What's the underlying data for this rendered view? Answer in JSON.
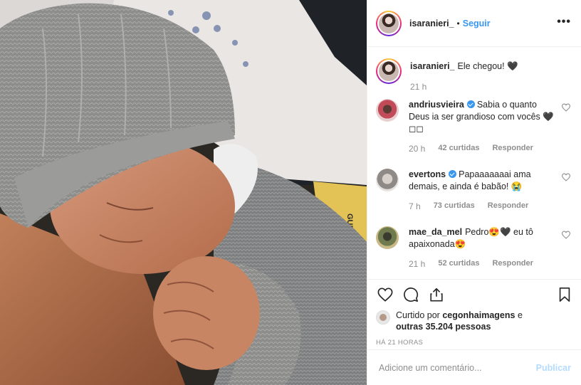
{
  "header": {
    "username": "isaranieri_",
    "separator": "•",
    "follow_label": "Seguir",
    "more_label": "•••"
  },
  "caption": {
    "username": "isaranieri_",
    "text": "Ele chegou! 🖤",
    "time": "21 h"
  },
  "comments": [
    {
      "username": "andriusvieira",
      "verified": true,
      "text": "Sabia o quanto Deus ia ser grandioso com vocês 🖤◻◻",
      "time": "20 h",
      "likes": "42 curtidas",
      "reply": "Responder"
    },
    {
      "username": "evertons",
      "verified": true,
      "text": "Papaaaaaaai ama demais, e ainda é babão! 😭",
      "time": "7 h",
      "likes": "73 curtidas",
      "reply": "Responder"
    },
    {
      "username": "mae_da_mel",
      "verified": false,
      "text": "Pedro😍🖤 eu tô apaixonada😍",
      "time": "21 h",
      "likes": "52 curtidas",
      "reply": "Responder"
    }
  ],
  "liked_by": {
    "prefix": "Curtido por",
    "user": "cegonhaimagens",
    "middle": "e",
    "others": "outras 35.204 pessoas"
  },
  "time_ago": "HÁ 21 HORAS",
  "add_comment": {
    "placeholder": "Adicione um comentário...",
    "post_label": "Publicar"
  },
  "colors": {
    "accent": "#3897f0",
    "text": "#262626",
    "muted": "#8e8e8e",
    "border": "#efefef",
    "post_disabled": "#b3dbff"
  },
  "photo": {
    "wristband_text": "GUEDA"
  }
}
